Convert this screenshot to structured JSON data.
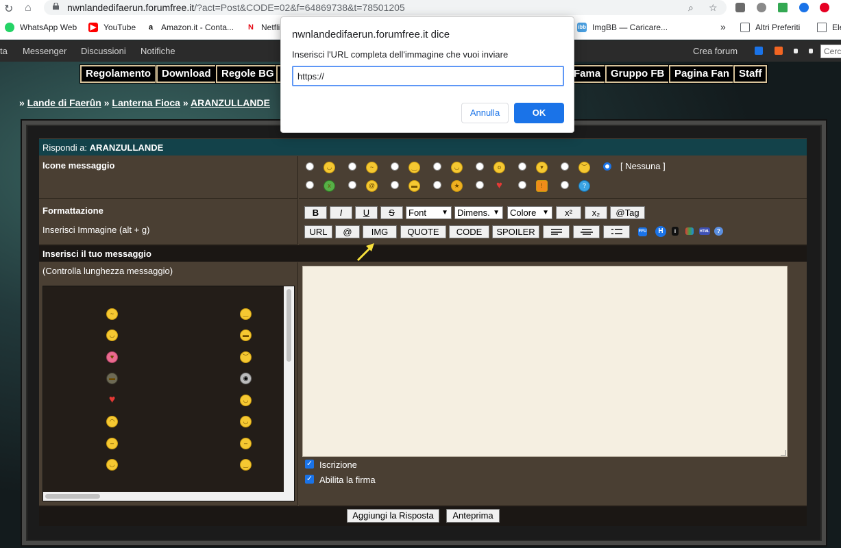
{
  "browser": {
    "url_host": "nwnlandedifaerun.forumfree.it",
    "url_rest": "/?act=Post&CODE=02&f=64869738&t=78501205"
  },
  "bookmarks": {
    "items": [
      "WhatsApp Web",
      "YouTube",
      "Amazon.it - Conta...",
      "Netfli",
      "ImgBB — Caricare..."
    ],
    "more": "»",
    "others": "Altri Preferiti",
    "reading_list": "Ele"
  },
  "topbar": {
    "left_cut": "ta",
    "messenger": "Messenger",
    "discussioni": "Discussioni",
    "notifiche": "Notifiche",
    "crea_forum": "Crea forum",
    "search_placeholder": "Cerc"
  },
  "menu": [
    "Regolamento",
    "Download",
    "Regole BG",
    "Fama",
    "Gruppo FB",
    "Pagina Fan",
    "Staff"
  ],
  "breadcrumb": {
    "sep": "»",
    "items": [
      "Lande di Faerûn",
      "Lanterna Fioca",
      "ARANZULLANDE"
    ]
  },
  "reply": {
    "prefix": "Rispondi a:",
    "topic": "ARANZULLANDE",
    "icons_label": "Icone messaggio",
    "none_label": "[ Nessuna ]",
    "formatting_label": "Formattazione",
    "insert_image_label": "Inserisci Immagine (alt + g)",
    "message_label": "Inserisci il tuo messaggio",
    "check_length": "(Controlla lunghezza messaggio)",
    "subscribe": "Iscrizione",
    "signature": "Abilita la firma",
    "submit": "Aggiungi la Risposta",
    "preview": "Anteprima"
  },
  "toolbar": {
    "bold": "B",
    "italic": "I",
    "underline": "U",
    "strike": "S",
    "font": "Font",
    "size": "Dimens.",
    "color": "Colore",
    "sup": "x²",
    "sub": "x₂",
    "tag": "@Tag",
    "url": "URL",
    "at": "@",
    "img": "IMG",
    "quote": "QUOTE",
    "code": "CODE",
    "spoiler": "SPOILER"
  },
  "dialog": {
    "title": "nwnlandedifaerun.forumfree.it dice",
    "message": "Inserisci l'URL completa dell'immagine che vuoi inviare",
    "input_value": "https://",
    "cancel": "Annulla",
    "ok": "OK"
  },
  "colors": {
    "accent": "#1a73e8",
    "panel": "#4a3f33",
    "header_teal": "#13424a",
    "menu_border": "#d8c39a",
    "arrow_yellow": "#f7e03c"
  }
}
